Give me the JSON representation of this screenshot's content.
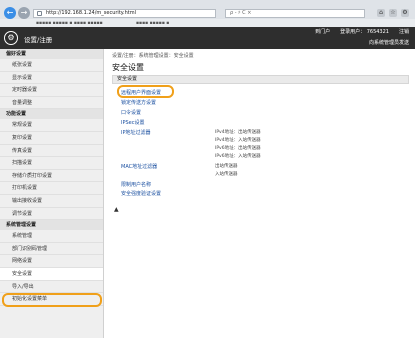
{
  "browser": {
    "back": "←",
    "forward": "→",
    "url": "http://192.168.1.24/m_security.html",
    "search": "ρ - ♯ C ×",
    "tabs": [
      "▪▪▪▪▪ ▪▪▪▪▪ ▪ ▪▪▪▪ ▪▪▪▪▪",
      "▪▪▪▪ ▪▪▪▪▪ ▪"
    ],
    "icons": [
      "⌂",
      "☆",
      "⚙"
    ]
  },
  "header": {
    "title": "设置/注册",
    "logout": "到门户",
    "login_user": "登录用户：",
    "user_id": "7654321",
    "logout_btn": "注销",
    "mail_link": "向系统管理员发送"
  },
  "sidebar": {
    "sections": [
      {
        "label": "偏好设置",
        "items": [
          "纸张设置",
          "显示设置",
          "定时器设置",
          "音量调整"
        ]
      },
      {
        "label": "功能设置",
        "items": [
          "常规设置",
          "复印设置",
          "传真设置",
          "扫描设置",
          "存储介质打印设置",
          "打印机设置",
          "输出接收设置",
          "调节设置"
        ]
      },
      {
        "label": "系统管理设置",
        "items": [
          "系统管理",
          "部门识别码管理",
          "网络设置",
          "安全设置",
          "导入/导出",
          "初始化设置菜单"
        ]
      }
    ]
  },
  "main": {
    "breadcrumb": "设置/注册：系统管理设置：安全设置",
    "title": "安全设置",
    "panel": "安全设置",
    "links": [
      "远程用户界面设置",
      "锁定传送方设置",
      "口令设置",
      "IPSec设置",
      "IP地址过滤器",
      "MAC地址过滤器",
      "限制用户名称",
      "安全强度验证设置"
    ],
    "ip_values": [
      "IPv4地址：出站传送器",
      "IPv4地址：入站传送器",
      "IPv6地址：出站传送器",
      "IPv6地址：入站传送器"
    ],
    "mac_values": [
      "出站传送器",
      "入站传送器"
    ],
    "top_marker": "▲"
  }
}
